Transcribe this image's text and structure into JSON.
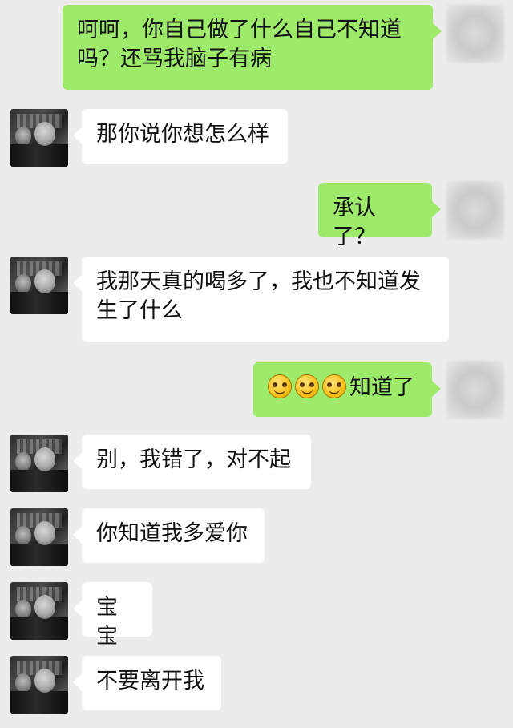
{
  "messages": [
    {
      "from": "self",
      "text": "呵呵，你自己做了什么自己不知道吗？还骂我脑子有病"
    },
    {
      "from": "other",
      "text": "那你说你想怎么样"
    },
    {
      "from": "self",
      "text": "承认了？"
    },
    {
      "from": "other",
      "text": "我那天真的喝多了，我也不知道发生了什么"
    },
    {
      "from": "self",
      "emoji_count": 3,
      "emoji": "smile-emoji",
      "text": "知道了"
    },
    {
      "from": "other",
      "text": "别，我错了，对不起"
    },
    {
      "from": "other",
      "text": "你知道我多爱你"
    },
    {
      "from": "other",
      "text": "宝宝"
    },
    {
      "from": "other",
      "text": "不要离开我"
    }
  ],
  "colors": {
    "background": "#ececec",
    "sent_bubble": "#9eea6a",
    "received_bubble": "#ffffff"
  }
}
